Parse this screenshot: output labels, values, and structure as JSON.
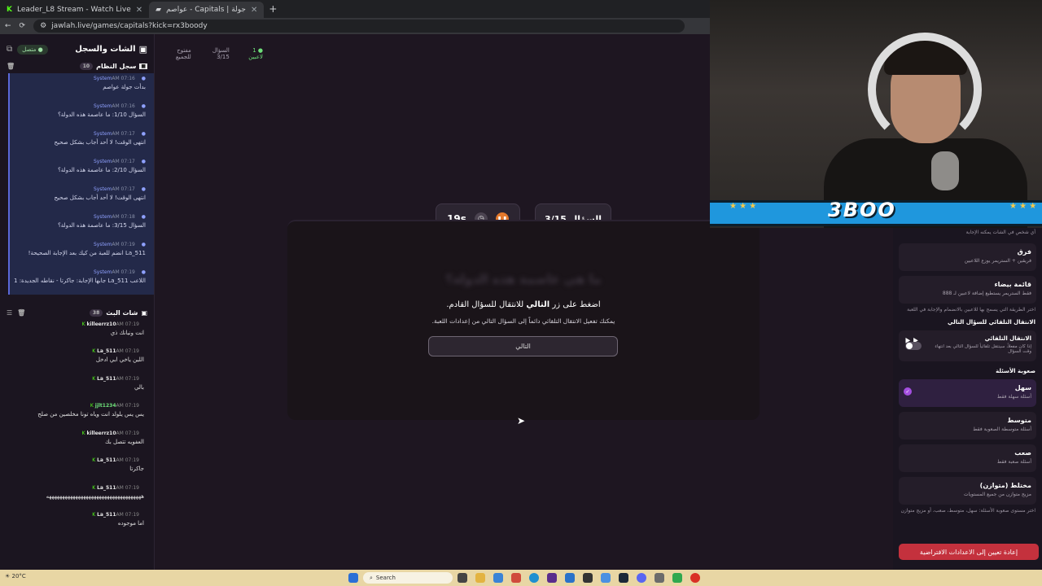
{
  "browser": {
    "tabs": [
      {
        "title": "Leader_L8 Stream - Watch Live",
        "active": false
      },
      {
        "title": "عواصم - Capitals | جولة",
        "active": true
      }
    ],
    "url": "jawlah.live/games/capitals?kick=rx3boody"
  },
  "sidebar": {
    "title": "الشات والسجل",
    "connection": "متصل",
    "system_log": {
      "title": "سجل النظام",
      "count": "10",
      "items": [
        {
          "sender": "System",
          "time": "AM 07:16",
          "text": "بدأت جولة عواصم"
        },
        {
          "sender": "System",
          "time": "AM 07:16",
          "text": "السؤال 1/10: ما عاصمة هذه الدولة؟"
        },
        {
          "sender": "System",
          "time": "AM 07:17",
          "text": "انتهى الوقت! لا أحد أجاب بشكل صحيح"
        },
        {
          "sender": "System",
          "time": "AM 07:17",
          "text": "السؤال 2/10: ما عاصمة هذه الدولة؟"
        },
        {
          "sender": "System",
          "time": "AM 07:17",
          "text": "انتهى الوقت! لا أحد أجاب بشكل صحيح"
        },
        {
          "sender": "System",
          "time": "AM 07:18",
          "text": "السؤال 3/15: ما عاصمة هذه الدولة؟"
        },
        {
          "sender": "System",
          "time": "AM 07:19",
          "text": "La_511 انضم للعبة من كيك بعد الإجابة الصحيحة!"
        },
        {
          "sender": "System",
          "time": "AM 07:19",
          "text": "اللاعب La_511 جابها الإجابة: جاكرتا - نقاطه الجديدة: 1"
        }
      ]
    },
    "live_chat": {
      "title": "شات البث",
      "count": "38",
      "items": [
        {
          "user": "killeerrz10",
          "time": "AM 07:19",
          "text": "انت ونيانك ذي"
        },
        {
          "user": "La_511",
          "time": "AM 07:19",
          "text": "اللين ياخي ابي ادخل"
        },
        {
          "user": "La_511",
          "time": "AM 07:19",
          "text": "بالي"
        },
        {
          "user": "jjlt1234",
          "time": "AM 07:19",
          "text": "يس يس يلولد انت وياه تونا مخلصين من صلح"
        },
        {
          "user": "killeerrz10",
          "time": "AM 07:19",
          "text": "العفويه تتصل بك"
        },
        {
          "user": "La_511",
          "time": "AM 07:19",
          "text": "جاكرتا"
        },
        {
          "user": "La_511",
          "time": "AM 07:19",
          "text": "ههههههههههههههههههههههههههههههههههههه"
        },
        {
          "user": "La_511",
          "time": "AM 07:19",
          "text": "اما موجوده"
        }
      ]
    }
  },
  "status": {
    "players": "1 لاعبين",
    "question": "السؤال 3/15",
    "open": "مفتوح للجميع"
  },
  "game": {
    "question_counter": "السؤال 3/15",
    "timer": "19s",
    "blurred_question": "ما هي عاصمة هذه الدولة؟",
    "overlay_title_pre": "اضغط على زر",
    "overlay_title_bold": "التالي",
    "overlay_title_post": "للانتقال للسؤال القادم.",
    "overlay_sub": "يمكنك تفعيل الانتقال التلقائي دائماً إلى السؤال التالي من إعدادات اللعبة.",
    "next_label": "التالي"
  },
  "settings": {
    "top_note": "أي شخص في الشات يمكنه الإجابة",
    "modes": [
      {
        "name": "فرق",
        "desc": "فريقين + الستريمر يوزع اللاعبين"
      },
      {
        "name": "قائمة بيضاء",
        "desc": "فقط الستريمر يستطيع إضافة لاعبين لـ 888"
      }
    ],
    "mode_note": "اختر الطريقة التي يسمح بها للاعبين بالانضمام والإجابة في اللعبة",
    "auto_next_label": "الانتقال التلقائي للسؤال التالي",
    "auto_next": {
      "name": "الانتقال التلقائي",
      "desc": "إذا كان مفعلاً، سينتقل تلقائياً للسؤال التالي بعد انتهاء وقت السؤال",
      "enabled": false
    },
    "difficulty_label": "صعوبة الأسئلة",
    "difficulties": [
      {
        "name": "سهل",
        "desc": "أسئلة سهلة فقط",
        "selected": true
      },
      {
        "name": "متوسط",
        "desc": "أسئلة متوسطة الصعوبة فقط",
        "selected": false
      },
      {
        "name": "صعب",
        "desc": "أسئلة صعبة فقط",
        "selected": false
      },
      {
        "name": "مختلط (متوازن)",
        "desc": "مزيج متوازن من جميع المستويات",
        "selected": false
      }
    ],
    "difficulty_note": "اختر مستوى صعوبة الأسئلة: سهل، متوسط، صعب، أو مزيج متوازن",
    "reset_label": "إعادة تعيين إلى الاعدادات الافتراضية"
  },
  "webcam": {
    "brand": "3BOO"
  },
  "taskbar": {
    "search_placeholder": "Search",
    "weather": "20°C"
  },
  "colors": {
    "accent_orange": "#e4792c",
    "system_blue": "#5a68d8",
    "reset_red": "#c4313d",
    "brand_blue": "#1f97dd",
    "kick_green": "#53fc18"
  }
}
